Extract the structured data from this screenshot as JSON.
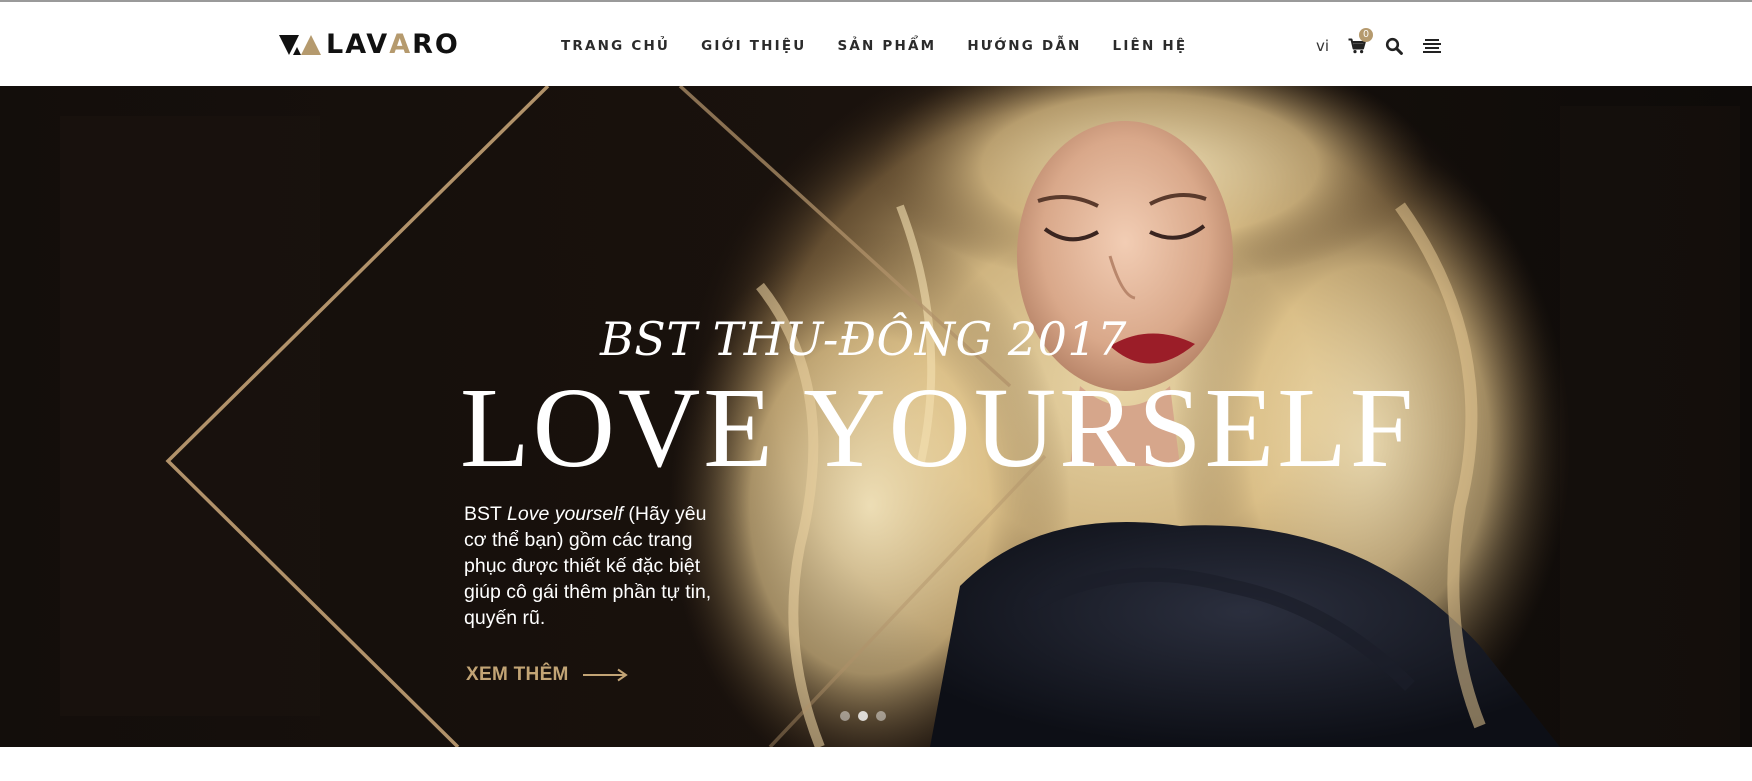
{
  "header": {
    "logo": {
      "prefix": "L",
      "mid": "AV",
      "accent": "A",
      "suffix": "RO",
      "icon": "triangle-logo-mark-icon"
    },
    "nav": [
      {
        "label": "TRANG CHỦ"
      },
      {
        "label": "GIỚI THIỆU"
      },
      {
        "label": "SẢN PHẨM"
      },
      {
        "label": "HƯỚNG DẪN"
      },
      {
        "label": "LIÊN HỆ"
      }
    ],
    "tools": {
      "language": "vi",
      "cart_icon": "shopping-cart-icon",
      "cart_count": "0",
      "search_icon": "search-icon",
      "menu_icon": "hamburger-menu-icon"
    }
  },
  "hero": {
    "subtitle": "BST THU-ĐÔNG 2017",
    "title": "LOVE YOURSELF",
    "description": {
      "before": "BST ",
      "emphasis": "Love yourself",
      "after": " (Hãy yêu cơ thể bạn) gồm các trang phục được thiết kế đặc biệt giúp cô gái thêm phần tự tin, quyến rũ."
    },
    "cta": {
      "label": "XEM THÊM",
      "icon": "arrow-right-icon"
    },
    "slides": {
      "total": 3,
      "active": 2
    }
  },
  "colors": {
    "accent": "#b59a6e",
    "cta": "#c2a475",
    "nav_text": "#2b2b2b",
    "hero_dark": "#0d0a08"
  }
}
